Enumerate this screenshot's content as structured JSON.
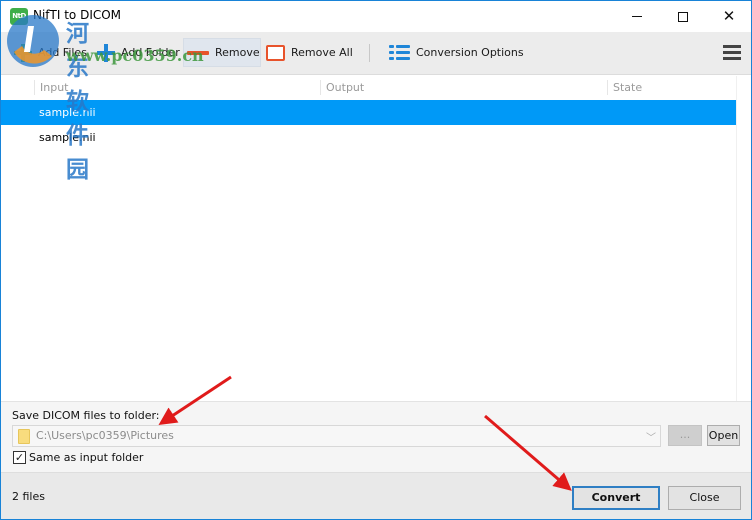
{
  "window": {
    "title": "NifTI to DICOM",
    "app_icon_text": "NtD",
    "controls": {
      "minimize": "minimize",
      "maximize": "maximize",
      "close": "✕"
    }
  },
  "toolbar": {
    "buttons": [
      {
        "label": "Add Files",
        "icon": "plus-green-icon"
      },
      {
        "label": "Add Folder",
        "icon": "plus-blue-icon"
      },
      {
        "label": "Remove",
        "icon": "minus-red-icon"
      },
      {
        "label": "Remove All",
        "icon": "square-red-icon"
      },
      {
        "label": "Conversion Options",
        "icon": "list-icon"
      }
    ],
    "menu_icon": "hamburger-menu-icon"
  },
  "file_list": {
    "columns": [
      "Input",
      "Output",
      "State"
    ],
    "rows": [
      {
        "input": "sample.nii",
        "output": "",
        "state": "",
        "selected": true
      },
      {
        "input": "sample.nii",
        "output": "",
        "state": "",
        "selected": false
      }
    ]
  },
  "save_panel": {
    "label": "Save DICOM files to folder:",
    "path": "C:\\Users\\pc0359\\Pictures",
    "browse_label": "...",
    "open_label": "Open",
    "same_as_input_label": "Same as input folder",
    "same_as_input_checked": true
  },
  "footer": {
    "file_count": "2 files",
    "convert_label": "Convert",
    "close_label": "Close"
  },
  "watermark": {
    "text": "河东软件园",
    "url": "www.pc0359.cn"
  },
  "colors": {
    "selection": "#0099f7",
    "accent_blue": "#1f86d8",
    "accent_red": "#e8532b",
    "accent_green": "#48b64f",
    "annotation_arrow": "#e01b1b"
  }
}
